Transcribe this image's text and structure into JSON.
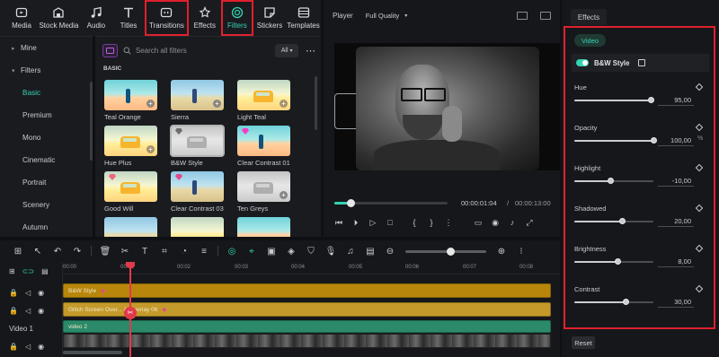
{
  "toolbar": {
    "items": [
      {
        "label": "Media",
        "icon": "media-icon"
      },
      {
        "label": "Stock Media",
        "icon": "stock-media-icon"
      },
      {
        "label": "Audio",
        "icon": "audio-icon"
      },
      {
        "label": "Titles",
        "icon": "titles-icon"
      },
      {
        "label": "Transitions",
        "icon": "transitions-icon"
      },
      {
        "label": "Effects",
        "icon": "effects-icon"
      },
      {
        "label": "Filters",
        "icon": "filters-icon"
      },
      {
        "label": "Stickers",
        "icon": "stickers-icon"
      },
      {
        "label": "Templates",
        "icon": "templates-icon"
      }
    ],
    "highlight_color": "#e0202e",
    "accent": "#34d3b1"
  },
  "leftnav": {
    "mine": "Mine",
    "filters": "Filters",
    "sub": [
      "Basic",
      "Premium",
      "Mono",
      "Cinematic",
      "Portrait",
      "Scenery",
      "Autumn"
    ]
  },
  "filters_panel": {
    "search_placeholder": "Search all filters",
    "all_label": "All",
    "more": "⋯",
    "section": "BASIC",
    "cards": [
      {
        "label": "Teal Orange"
      },
      {
        "label": "Sierra"
      },
      {
        "label": "Light Teal"
      },
      {
        "label": "Hue Plus"
      },
      {
        "label": "B&W Style"
      },
      {
        "label": "Clear Contrast 01"
      },
      {
        "label": "Good Will"
      },
      {
        "label": "Clear Contrast 03"
      },
      {
        "label": "Ten Greys"
      }
    ]
  },
  "player": {
    "label": "Player",
    "quality": "Full Quality",
    "progress": 0.14,
    "current_time": "00:00:01:04",
    "slash": "/",
    "total_time": "00:00:13:00"
  },
  "timeline": {
    "ticks": [
      "00:00",
      "00:01",
      "00:02",
      "00:03",
      "00:04",
      "00:05",
      "00:06",
      "00:07",
      "00:08"
    ],
    "clips": {
      "bw": "B&W Style",
      "glitch": "Glitch Screen Over... & Overlay 06",
      "video": "video 2"
    },
    "track_label": "Video 1",
    "zoom_level": 0.56
  },
  "effects": {
    "tab": "Effects",
    "video_tag": "Video",
    "effect_name": "B&W Style",
    "params": [
      {
        "name": "Hue",
        "value": "95,00",
        "unit": "",
        "level": 0.97
      },
      {
        "name": "Opacity",
        "value": "100,00",
        "unit": "%",
        "level": 1.0
      },
      {
        "name": "Highlight",
        "value": "-10,00",
        "unit": "",
        "level": 0.45
      },
      {
        "name": "Shadowed",
        "value": "20,00",
        "unit": "",
        "level": 0.6
      },
      {
        "name": "Brightness",
        "value": "8,00",
        "unit": "",
        "level": 0.54
      },
      {
        "name": "Contrast",
        "value": "30,00",
        "unit": "",
        "level": 0.65
      }
    ],
    "reset": "Reset"
  }
}
